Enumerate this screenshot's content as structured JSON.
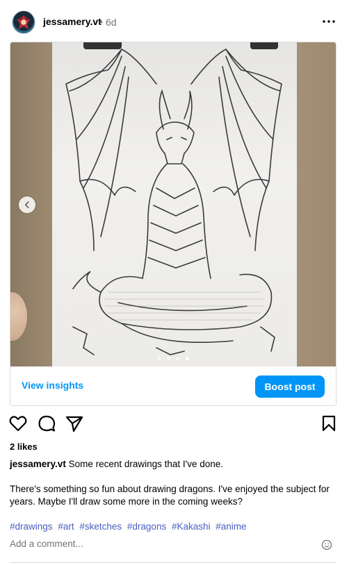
{
  "post": {
    "username": "jessamery.vt",
    "separator": "•",
    "time": "6d",
    "more_icon": "more-horizontal-icon"
  },
  "media": {
    "slides": 4,
    "active_slide": 4,
    "prev_icon": "chevron-left-icon"
  },
  "insights": {
    "view_label": "View insights",
    "boost_label": "Boost post",
    "accent": "#0095f6"
  },
  "actions": {
    "like_icon": "heart-icon",
    "comment_icon": "comment-icon",
    "share_icon": "send-icon",
    "save_icon": "bookmark-icon"
  },
  "likes": "2 likes",
  "caption": {
    "username": "jessamery.vt",
    "first_line": "Some recent drawings that I've done.",
    "paragraph": "There's something so fun about drawing dragons. I've enjoyed the subject for years. Maybe I'll draw some more in the coming weeks?"
  },
  "hashtags": [
    "#drawings",
    "#art",
    "#sketches",
    "#dragons",
    "#Kakashi",
    "#anime"
  ],
  "comment": {
    "placeholder": "Add a comment...",
    "emoji_icon": "smiley-icon"
  }
}
